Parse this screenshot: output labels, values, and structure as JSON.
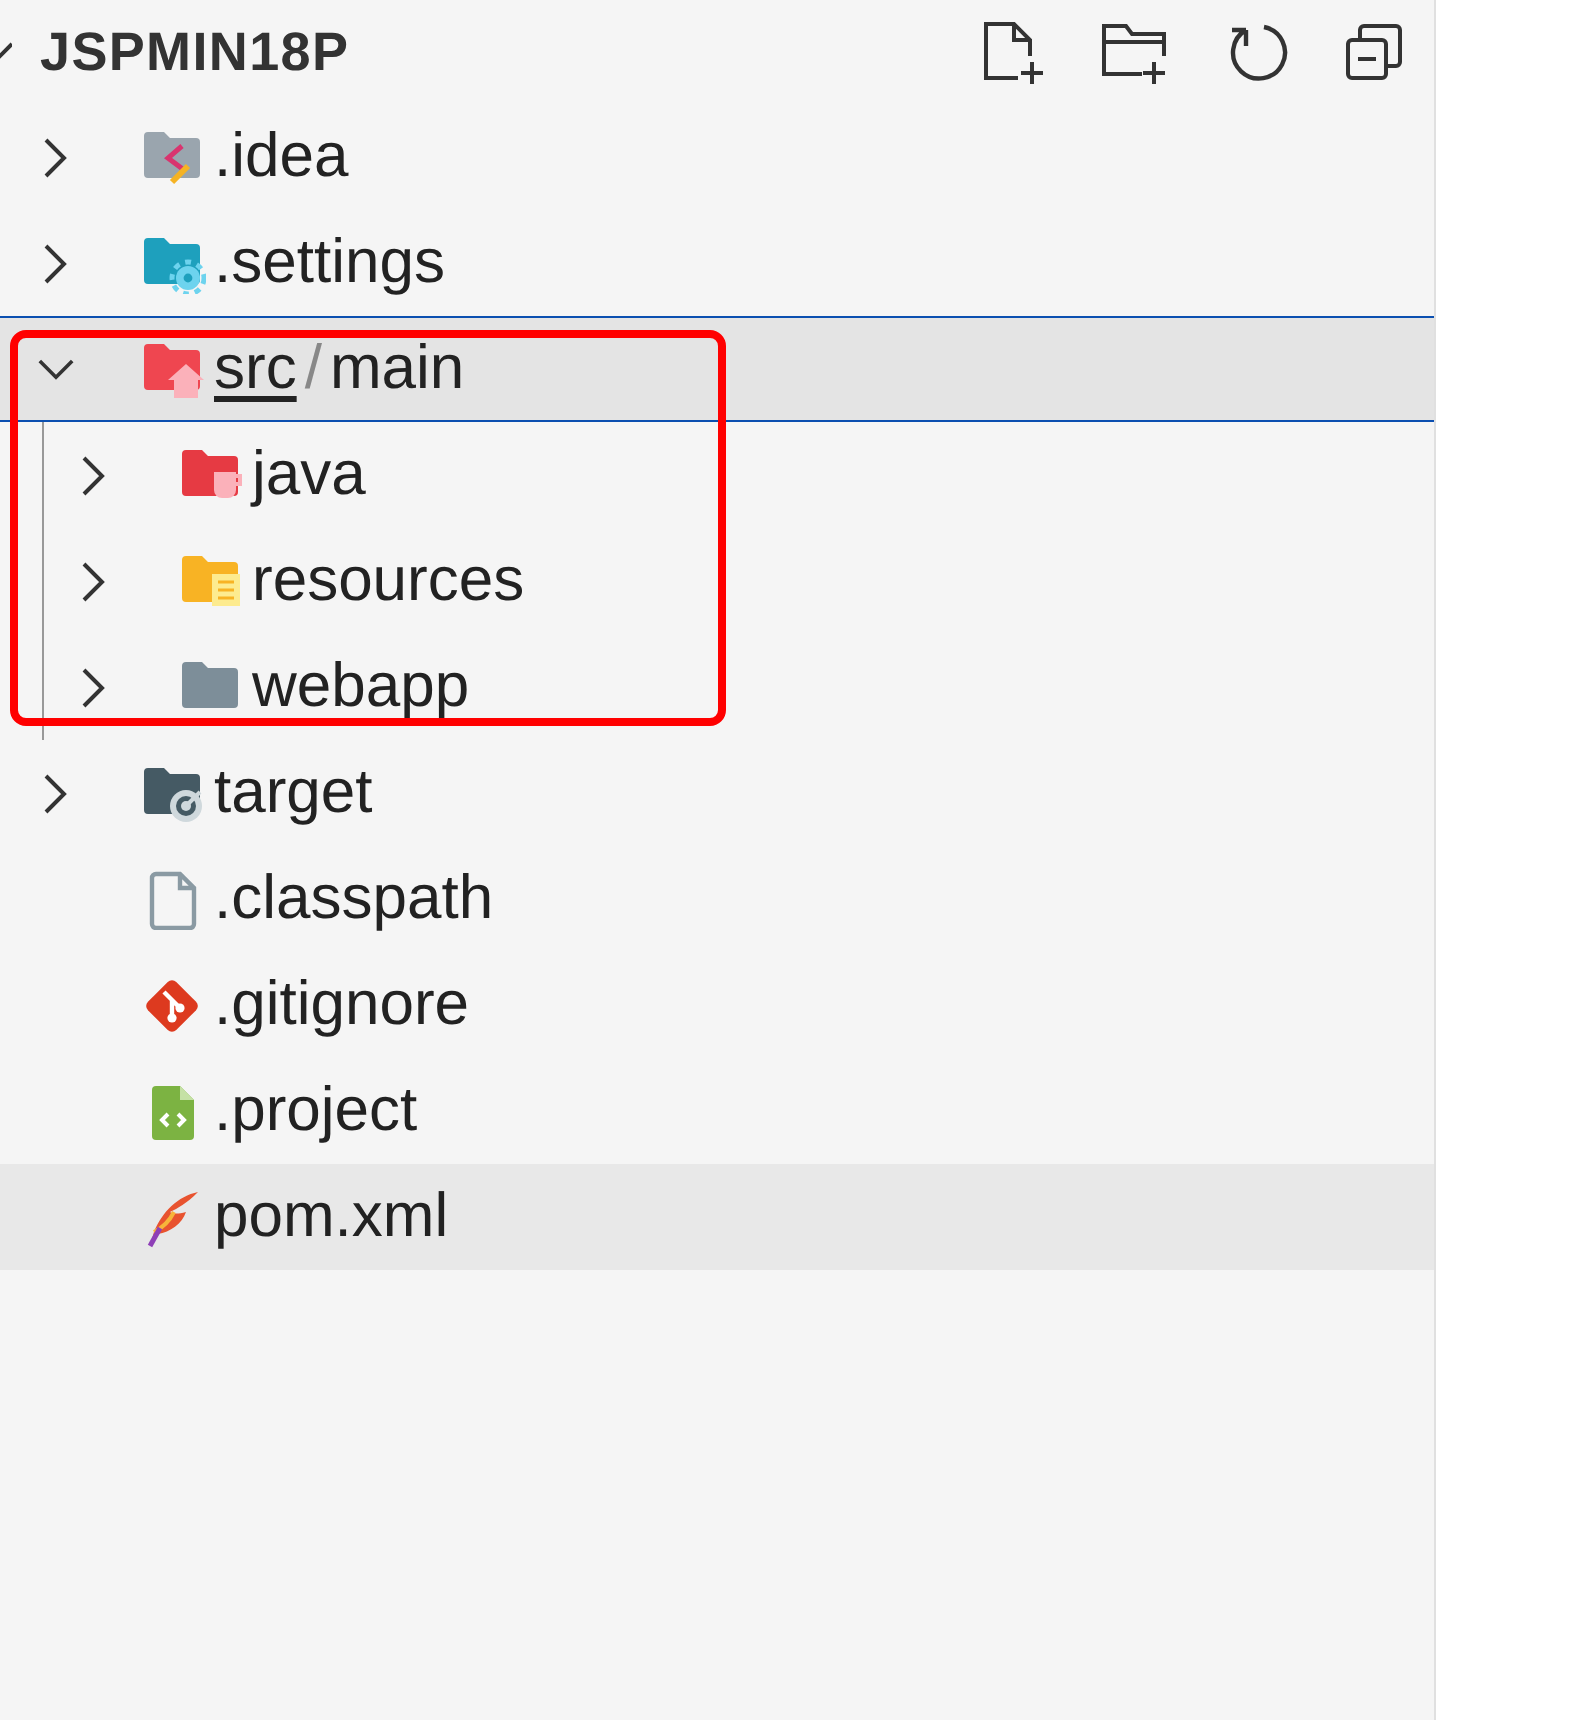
{
  "explorer": {
    "title": "JSPMIN18P",
    "expanded": true,
    "tree": [
      {
        "label": ".idea",
        "kind": "idea-folder",
        "expanded": false,
        "selected": false,
        "hovered": false
      },
      {
        "label": ".settings",
        "kind": "settings-folder",
        "expanded": false,
        "selected": false,
        "hovered": false
      },
      {
        "label_parts": [
          {
            "text": "src",
            "underlined": true
          },
          {
            "text": "/",
            "kind": "separator"
          },
          {
            "text": "main",
            "underlined": false
          }
        ],
        "kind": "source-folder",
        "expanded": true,
        "selected": true,
        "hovered": false,
        "outlined": true,
        "children": [
          {
            "label": "java",
            "kind": "java-folder",
            "expanded": false,
            "selected": false,
            "hovered": false
          },
          {
            "label": "resources",
            "kind": "resources-folder",
            "expanded": false,
            "selected": false,
            "hovered": false
          },
          {
            "label": "webapp",
            "kind": "plain-folder",
            "expanded": false,
            "selected": false,
            "hovered": false
          }
        ]
      },
      {
        "label": "target",
        "kind": "target-folder",
        "expanded": false,
        "selected": false,
        "hovered": false
      },
      {
        "label": ".classpath",
        "kind": "plain-file",
        "selected": false,
        "hovered": false
      },
      {
        "label": ".gitignore",
        "kind": "git-file",
        "selected": false,
        "hovered": false
      },
      {
        "label": ".project",
        "kind": "project-file",
        "selected": false,
        "hovered": false
      },
      {
        "label": "pom.xml",
        "kind": "maven-file",
        "selected": false,
        "hovered": true
      }
    ]
  }
}
